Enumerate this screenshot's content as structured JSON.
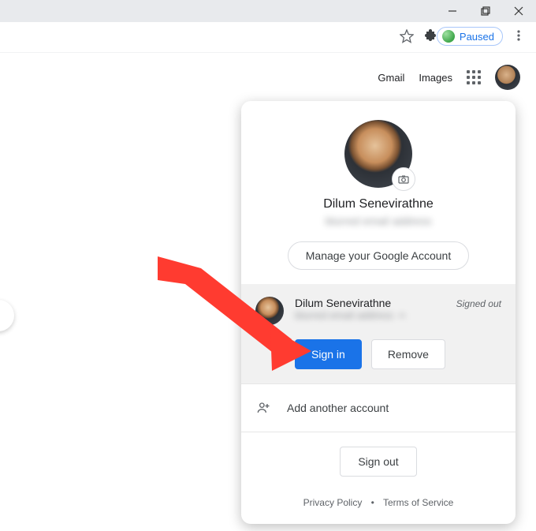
{
  "window": {
    "minimize": "minimize",
    "restore": "restore",
    "close": "close"
  },
  "toolbar": {
    "paused_label": "Paused"
  },
  "gnav": {
    "gmail": "Gmail",
    "images": "Images"
  },
  "card": {
    "user_name": "Dilum Senevirathne",
    "user_email": "blurred email address",
    "manage_label": "Manage your Google Account",
    "acct2": {
      "name": "Dilum Senevirathne",
      "email": "blurred email address",
      "status": "Signed out",
      "sign_in": "Sign in",
      "remove": "Remove"
    },
    "add_another": "Add another account",
    "sign_out": "Sign out",
    "privacy": "Privacy Policy",
    "tos": "Terms of Service"
  }
}
